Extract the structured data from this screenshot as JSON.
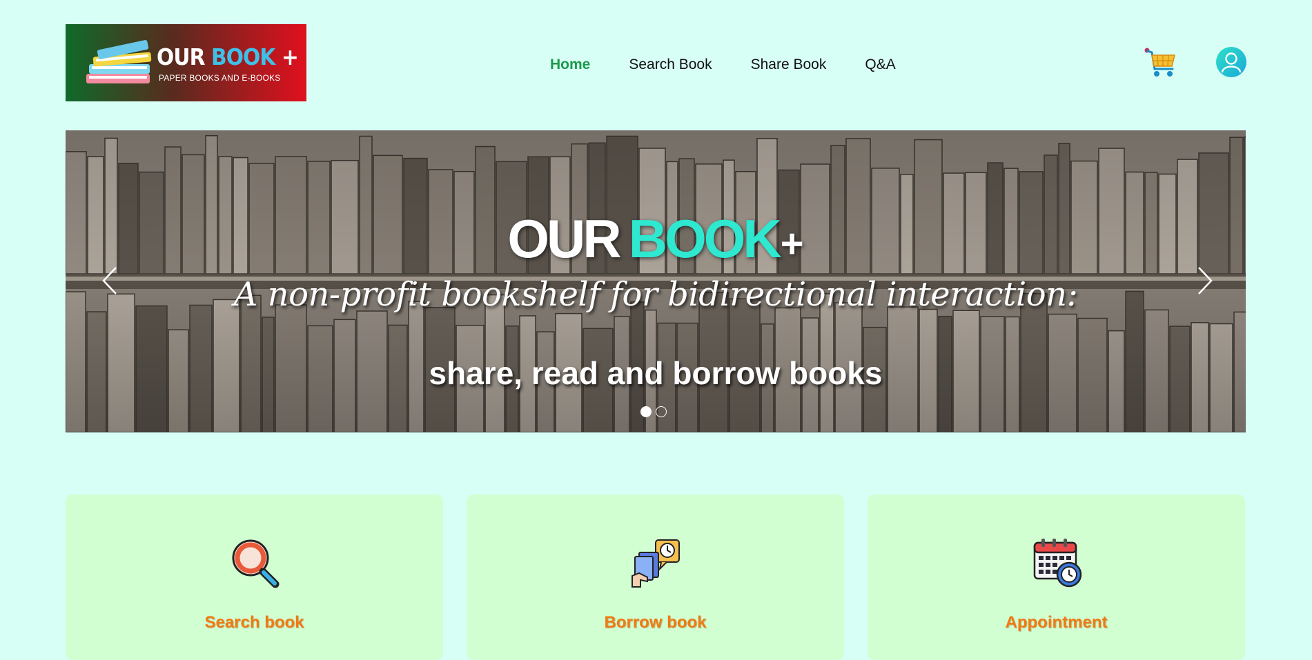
{
  "header": {
    "logo": {
      "brand_main": "OUR ",
      "brand_accent": "BOOK",
      "brand_plus": " +",
      "tagline": "PAPER BOOKS AND E-BOOKS"
    },
    "nav": [
      {
        "label": "Home",
        "active": true
      },
      {
        "label": "Search Book",
        "active": false
      },
      {
        "label": "Share Book",
        "active": false
      },
      {
        "label": "Q&A",
        "active": false
      }
    ],
    "cart_icon": "shopping-cart-icon",
    "user_icon": "user-avatar-icon"
  },
  "hero": {
    "title_our": "OUR",
    "title_book": "BOOK",
    "title_plus": "+",
    "slogan": "A non-profit bookshelf for bidirectional interaction:",
    "subtitle": "share, read and borrow books",
    "slides_total": 2,
    "active_slide": 1
  },
  "features": [
    {
      "label": "Search book",
      "icon": "magnifier-icon"
    },
    {
      "label": "Borrow book",
      "icon": "borrow-book-icon"
    },
    {
      "label": "Appointment",
      "icon": "calendar-clock-icon"
    }
  ],
  "colors": {
    "page_bg": "#d8fff5",
    "card_bg": "#d2ffd2",
    "nav_active": "#1a9a4a",
    "card_label": "#f07a12",
    "brand_accent": "#2ee8d0"
  }
}
